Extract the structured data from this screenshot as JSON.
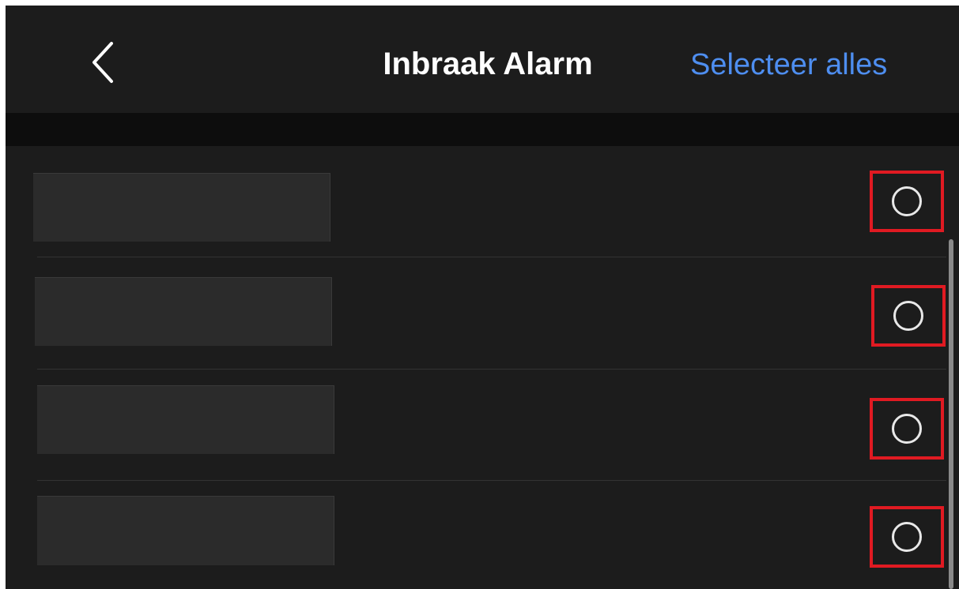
{
  "header": {
    "back_icon": "chevron-left-icon",
    "title": "Inbraak Alarm",
    "select_all_label": "Selecteer alles"
  },
  "colors": {
    "background": "#1c1c1c",
    "accent_link": "#4e8ef0",
    "highlight_box": "#e01a22",
    "radio_stroke": "#e8e8e8"
  },
  "list": {
    "items": [
      {
        "thumbnail": "redacted",
        "selected": false
      },
      {
        "thumbnail": "redacted",
        "selected": false
      },
      {
        "thumbnail": "redacted",
        "selected": false
      },
      {
        "thumbnail": "redacted",
        "selected": false
      }
    ]
  }
}
